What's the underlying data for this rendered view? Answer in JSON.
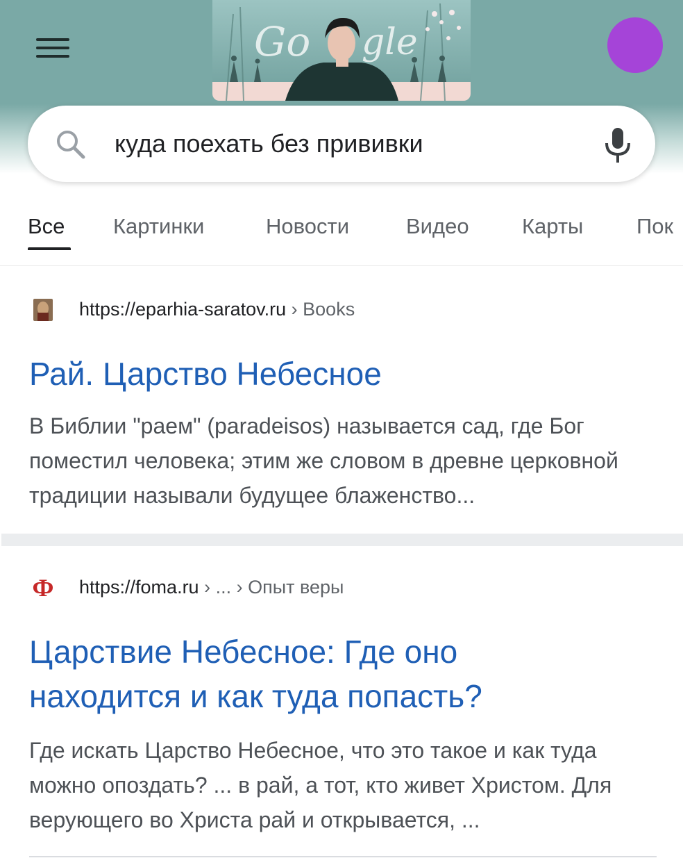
{
  "header": {
    "menu_icon": "hamburger-menu-icon",
    "doodle_logo_text": "Google",
    "avatar_color": "#a544d8"
  },
  "search": {
    "query": "куда поехать без прививки",
    "search_icon": "search-icon",
    "mic_icon": "microphone-icon"
  },
  "tabs": [
    {
      "label": "Все",
      "active": true
    },
    {
      "label": "Картинки"
    },
    {
      "label": "Новости"
    },
    {
      "label": "Видео"
    },
    {
      "label": "Карты"
    },
    {
      "label": "Пок"
    }
  ],
  "results": [
    {
      "favicon": "icon-favicon",
      "url_host": "https://eparhia-saratov.ru",
      "url_path": " › Books",
      "title": "Рай. Царство Небесное",
      "snippet": "В Библии \"раем\" (paradeisos) называется сад, где Бог поместил человека; этим же словом в древне церковной традиции называли будущее блаженство..."
    },
    {
      "favicon": "Ф",
      "url_host": "https://foma.ru",
      "url_path": " › ... › Опыт веры",
      "title": "Царствие Небесное: Где оно находится и как туда попасть?",
      "snippet": "Где искать Царство Небесное, что это такое и как туда можно опоздать? ... в рай, а тот, кто живет Христом. Для верующего во Христа рай и открывается, ..."
    }
  ],
  "colors": {
    "header_teal": "#7aa9a6",
    "link_blue": "#1f5fb5",
    "foma_red": "#c62828"
  }
}
